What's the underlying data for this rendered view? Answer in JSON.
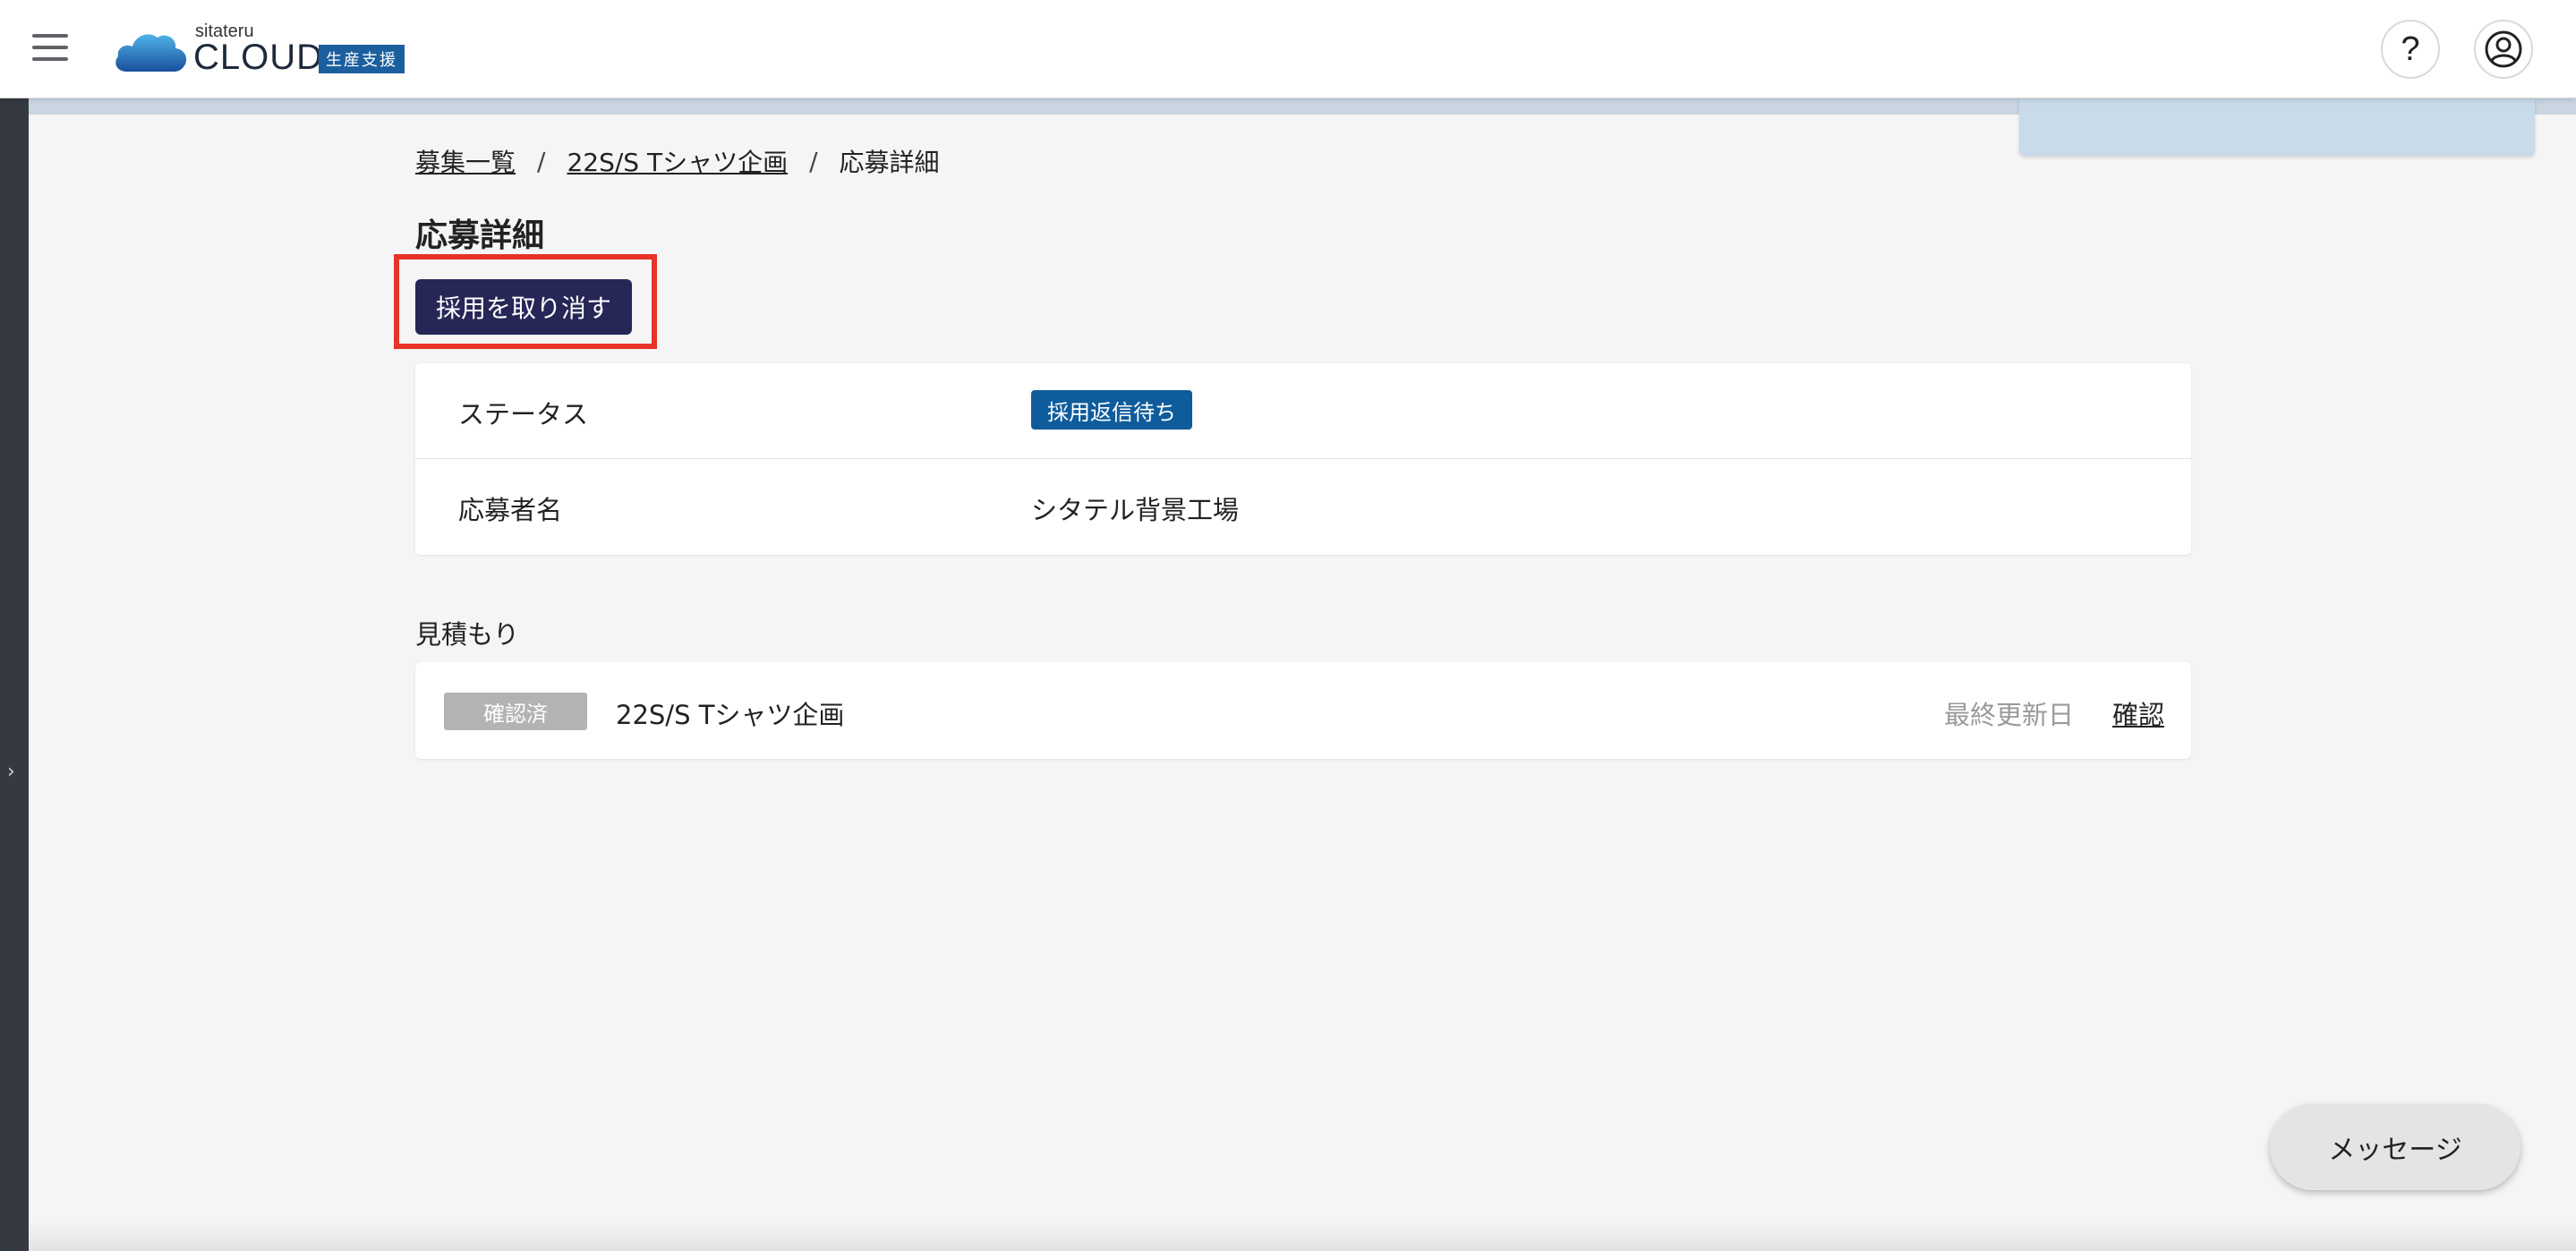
{
  "header": {
    "brand_small": "sitateru",
    "brand_big": "CLOUD",
    "brand_tag": "生産支援",
    "help_glyph": "?"
  },
  "icons": {
    "menu": "hamburger-menu-icon",
    "help": "help-icon",
    "user": "user-account-icon",
    "sidebar_toggle": "chevron-right-icon"
  },
  "breadcrumb": {
    "items": [
      "募集一覧",
      "22S/S Tシャツ企画",
      "応募詳細"
    ],
    "separator": "/"
  },
  "page": {
    "title": "応募詳細",
    "cancel_button": "採用を取り消す"
  },
  "details": {
    "status_label": "ステータス",
    "status_value": "採用返信待ち",
    "applicant_label": "応募者名",
    "applicant_value": "シタテル背景工場"
  },
  "estimate": {
    "section_title": "見積もり",
    "badge": "確認済",
    "name": "22S/S Tシャツ企画",
    "updated_label": "最終更新日",
    "confirm_link": "確認"
  },
  "message_button": "メッセージ",
  "colors": {
    "primary_button": "#262757",
    "status_badge": "#0f5c9c",
    "highlight": "#e8322a",
    "brand_tag": "#1c5f9e"
  }
}
